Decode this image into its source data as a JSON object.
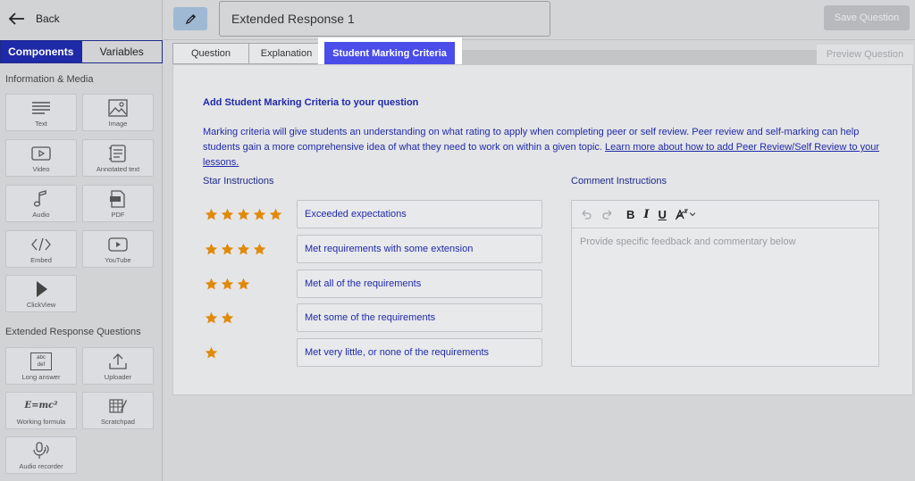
{
  "sidebar": {
    "back_label": "Back",
    "tabs": [
      {
        "label": "Components",
        "active": true
      },
      {
        "label": "Variables",
        "active": false
      }
    ],
    "section_info": "Information & Media",
    "section_extended": "Extended Response Questions",
    "info_items": [
      {
        "label": "Text",
        "icon": "text-lines-icon"
      },
      {
        "label": "Image",
        "icon": "image-icon"
      },
      {
        "label": "Video",
        "icon": "video-icon"
      },
      {
        "label": "Annotated text",
        "icon": "annotated-text-icon"
      },
      {
        "label": "Audio",
        "icon": "music-note-icon"
      },
      {
        "label": "PDF",
        "icon": "pdf-file-icon"
      },
      {
        "label": "Embed",
        "icon": "code-brackets-icon"
      },
      {
        "label": "YouTube",
        "icon": "youtube-play-icon"
      },
      {
        "label": "ClickView",
        "icon": "play-triangle-icon"
      }
    ],
    "extended_items": [
      {
        "label": "Long answer",
        "icon": "long-answer-icon",
        "glyph_top": "abc",
        "glyph_bottom": "def"
      },
      {
        "label": "Uploader",
        "icon": "upload-icon"
      },
      {
        "label": "Working formula",
        "icon": "formula-icon",
        "glyph": "E=mc²"
      },
      {
        "label": "Scratchpad",
        "icon": "scratchpad-icon"
      },
      {
        "label": "Audio recorder",
        "icon": "microphone-icon"
      }
    ]
  },
  "header": {
    "question_title": "Extended Response 1",
    "save_label": "Save Question",
    "preview_label": "Preview Question"
  },
  "tabs": [
    {
      "label": "Question",
      "active": false
    },
    {
      "label": "Explanation",
      "active": false
    },
    {
      "label": "Student Marking Criteria",
      "active": true
    }
  ],
  "criteria": {
    "heading": "Add Student Marking Criteria to your question",
    "description": "Marking criteria will give students an understanding on what rating to apply when completing peer or self review. Peer review and self-marking can help students gain a more comprehensive idea of what they need to work on within a given topic. ",
    "learn_more_link": "Learn more about how to add Peer Review/Self Review to your lessons.",
    "star_label": "Star Instructions",
    "comment_label": "Comment Instructions",
    "rows": [
      {
        "stars": 5,
        "text": "Exceeded expectations"
      },
      {
        "stars": 4,
        "text": "Met requirements with some extension"
      },
      {
        "stars": 3,
        "text": "Met all of the requirements"
      },
      {
        "stars": 2,
        "text": "Met some of the requirements"
      },
      {
        "stars": 1,
        "text": "Met very little, or none of the requirements"
      }
    ],
    "comment_placeholder": "Provide specific feedback and commentary below"
  },
  "colors": {
    "accent": "#4a4de8",
    "brand_dark": "#1f2aa8",
    "star": "#e08a0b"
  }
}
